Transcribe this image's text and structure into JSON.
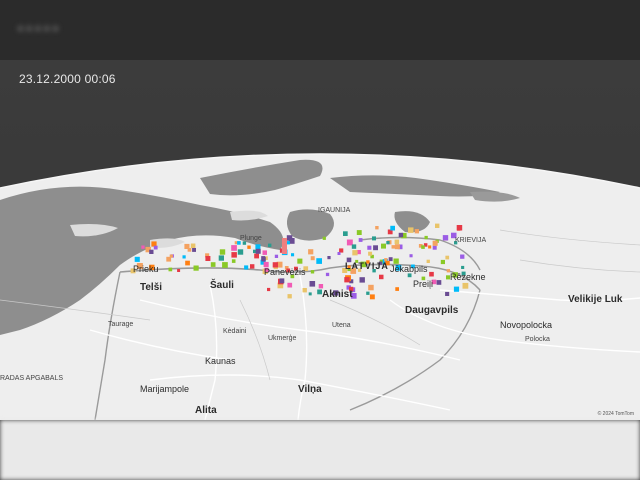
{
  "header": {
    "title": "• • • • •"
  },
  "timestamp": "23.12.2000 00:06",
  "map": {
    "labels": {
      "latvija": "LATVIJA",
      "daugavpils": "Daugavpils",
      "aknist": "Aknist",
      "velikije_luki": "Velikije Luk",
      "novopolocka": "Novopolocka",
      "polocka": "Polocka",
      "telsi": "Telši",
      "sauli": "Šauli",
      "kaunas": "Kaunas",
      "marijampole": "Marijampole",
      "alita": "Alita",
      "vilna": "Vilņa",
      "ukmerge": "Ukmerģe",
      "utena": "Utena",
      "kedaini": "Kėdaini",
      "taurage": "Taurage",
      "panevezis": "Panevėžis",
      "rezekne": "Rēzekne",
      "preiji": "Preiļi",
      "plunge": "Plunge",
      "prieku": "Prieku",
      "jekabpils": "Jēkabpils",
      "igaunija": "IGAUNIJA",
      "krievija": "KRIEVIJA",
      "apgabals": "RADAS APGABALS"
    },
    "attribution": "© 2024 TomTom"
  },
  "markers": {
    "colors": [
      "#e63946",
      "#f4a261",
      "#e9c46a",
      "#2a9d8f",
      "#9b5de5",
      "#f15bb5",
      "#00bbf9",
      "#8ac926",
      "#ff7f11",
      "#6a4c93"
    ]
  }
}
